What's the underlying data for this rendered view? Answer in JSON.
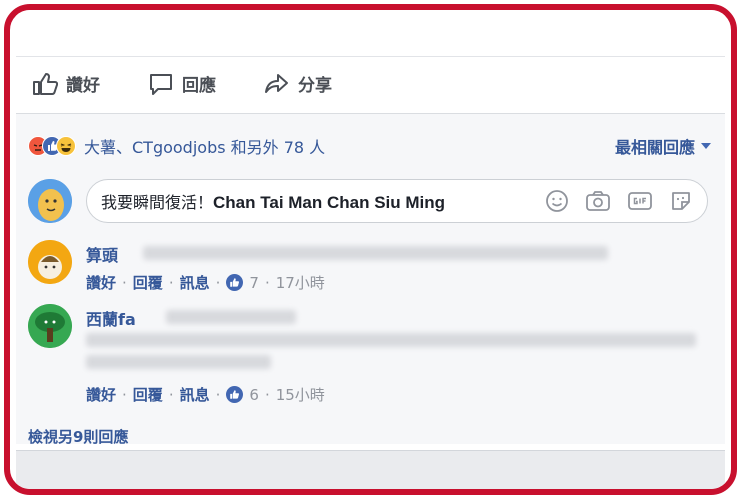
{
  "actions": {
    "like_label": "讚好",
    "comment_label": "回應",
    "share_label": "分享"
  },
  "reactions": {
    "icons": [
      "angry-icon",
      "like-icon",
      "haha-icon"
    ],
    "summary": "大薯、CTgoodjobs 和另外 78 人",
    "sort_label": "最相關回應"
  },
  "composer": {
    "text_prefix": "我要瞬間復活！",
    "text_bold": "Chan Tai Man Chan Siu Ming",
    "icons": [
      "emoji-icon",
      "camera-icon",
      "gif-icon",
      "sticker-icon"
    ]
  },
  "comments": [
    {
      "name": "算頭",
      "like_label": "讚好",
      "reply_label": "回覆",
      "message_label": "訊息",
      "like_count": "7",
      "time": "17小時"
    },
    {
      "name": "西蘭fa",
      "like_label": "讚好",
      "reply_label": "回覆",
      "message_label": "訊息",
      "like_count": "6",
      "time": "15小時"
    }
  ],
  "more_comments": "檢視另9則回應",
  "colors": {
    "frame": "#c8102e",
    "link": "#365899",
    "like_blue": "#4267b2"
  }
}
